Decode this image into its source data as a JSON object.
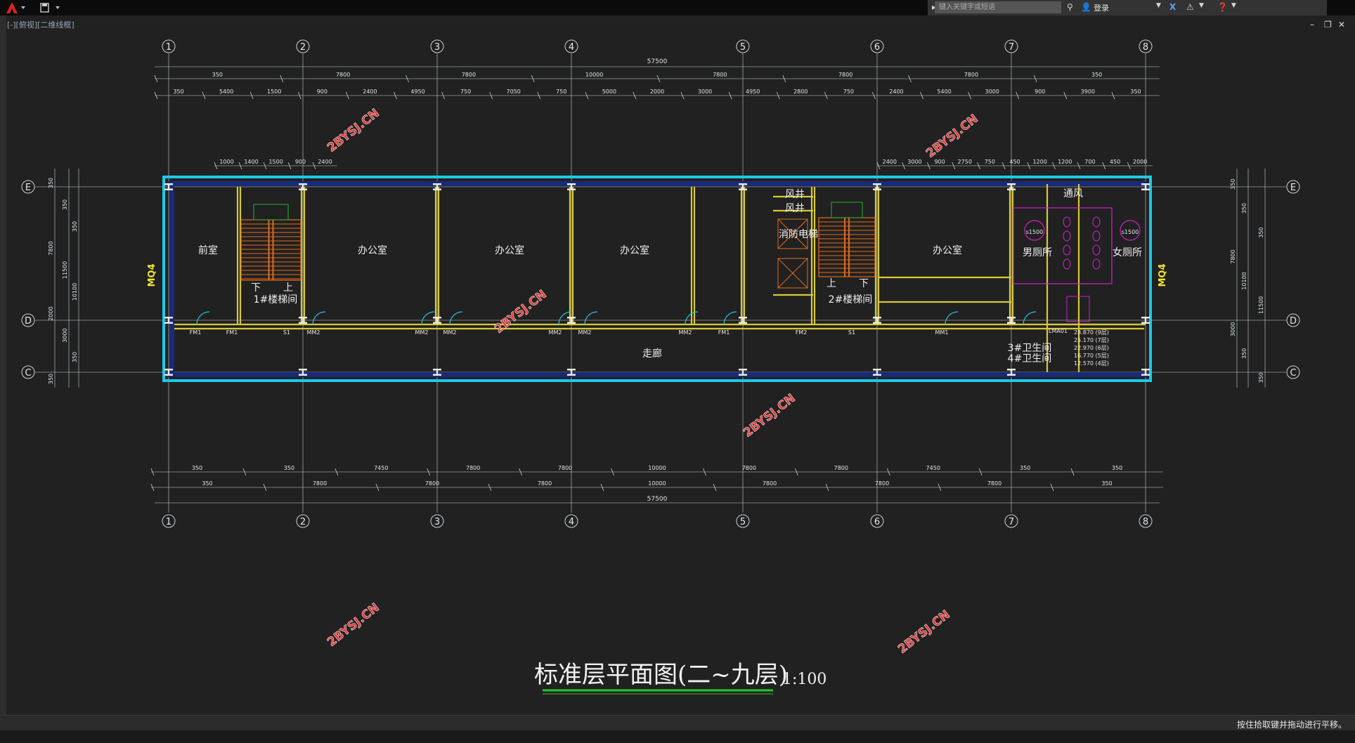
{
  "toolbar": {
    "search_placeholder": "键入关键字或短语",
    "login_label": "登录"
  },
  "viewport": {
    "label": "[-][俯视][二维线框]"
  },
  "status": {
    "message": "按住拾取键并拖动进行平移。"
  },
  "colors": {
    "background": "#212121",
    "grid_line": "#c9d4da",
    "wall_yellow": "#d6c93a",
    "outer_wall_cyan": "#1ec8e6",
    "stair_orange": "#e06a1c",
    "fixture_magenta": "#d020d0",
    "watermark_red": "#e23a3a",
    "title_underline": "#27c627"
  },
  "plan": {
    "title": "标准层平面图(二~九层)",
    "scale": "1:100",
    "watermark": "2BYSJ.CN",
    "grid_columns": [
      "1",
      "2",
      "3",
      "4",
      "5",
      "6",
      "7",
      "8"
    ],
    "grid_rows": [
      "E",
      "D",
      "C"
    ],
    "rooms": {
      "front_room": "前室",
      "office": "办公室",
      "stair1": "1#楼梯间",
      "stair2": "2#楼梯间",
      "corridor": "走廊",
      "wind_shaft": "风井",
      "fire_elevator": "消防电梯",
      "mens_toilet": "男厕所",
      "womens_toilet": "女厕所",
      "ventilation": "通风",
      "sanitary_3": "3#卫生间",
      "sanitary_4": "4#卫生间",
      "down": "下",
      "up": "上"
    },
    "wall_tags": {
      "left": "MQ4",
      "right": "MQ4"
    },
    "door_tags": [
      "FM1",
      "MM2",
      "MM2",
      "MM2",
      "MM2",
      "MM2",
      "MM2",
      "FM1",
      "MM1",
      "S1",
      "S1",
      "FM2",
      "FM1"
    ],
    "dims_top_overall": "57500",
    "dims_top_row1": [
      "350",
      "7800",
      "7800",
      "10000",
      "7800",
      "7800",
      "7800",
      "350"
    ],
    "dims_top_row2": [
      "350",
      "5400",
      "1500",
      "900",
      "2400",
      "4950",
      "750",
      "7050",
      "750",
      "5000",
      "2000",
      "3000",
      "4950",
      "2800",
      "750",
      "2400",
      "5400",
      "3000",
      "900",
      "3900",
      "350"
    ],
    "dims_bottom_row1": [
      "350",
      "350",
      "7450",
      "7800",
      "7800",
      "10000",
      "7800",
      "7800",
      "7450",
      "350",
      "350"
    ],
    "dims_bottom_row2": [
      "350",
      "7800",
      "7800",
      "7800",
      "10000",
      "7800",
      "7800",
      "7800",
      "350"
    ],
    "dims_bottom_overall": "57500",
    "dims_left": [
      "350",
      "350",
      "350",
      "7800",
      "11500",
      "10100",
      "2000",
      "3000",
      "350",
      "350"
    ],
    "dims_right": [
      "350",
      "350",
      "350",
      "7800",
      "10100",
      "11500",
      "3000",
      "350",
      "350"
    ],
    "dims_local_left": [
      "1000",
      "1400",
      "1500",
      "900",
      "2400"
    ],
    "dims_local_right": [
      "2400",
      "3000",
      "900",
      "2750",
      "750",
      "450",
      "1200",
      "1200",
      "700",
      "450",
      "2000"
    ],
    "elevations": [
      "28.870 (9层)",
      "25.170 (7层)",
      "22.970 (6层)",
      "16.770 (5层)",
      "12.570 (4层)"
    ],
    "fixture_label": "s1500",
    "lm_tag": "LMA01"
  }
}
